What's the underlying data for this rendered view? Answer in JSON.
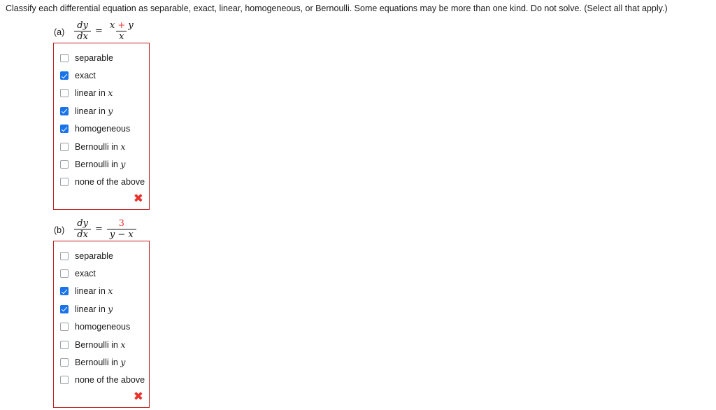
{
  "prompt": "Classify each differential equation as separable, exact, linear, homogeneous, or Bernoulli. Some equations may be more than one kind. Do not solve. (Select all that apply.)",
  "colors": {
    "box_border": "#c41f1f",
    "checkbox_checked": "#1a73e8",
    "highlight_red": "#e8322c",
    "text": "#1a1a1a"
  },
  "problems": [
    {
      "label": "(a)",
      "equation": {
        "lhs_num": "dy",
        "lhs_den": "dx",
        "relation": "=",
        "rhs_num_parts": [
          {
            "text": "x",
            "color": "black"
          },
          {
            "text": "+",
            "color": "red"
          },
          {
            "text": "y",
            "color": "black"
          }
        ],
        "rhs_num_plain": "x + y",
        "rhs_den": "x",
        "plain": "dy/dx = (x + y)/x"
      },
      "options": [
        {
          "label": "separable",
          "checked": false
        },
        {
          "label": "exact",
          "checked": true
        },
        {
          "label": "linear in ",
          "italic": "x",
          "checked": false
        },
        {
          "label": "linear in ",
          "italic": "y",
          "checked": true
        },
        {
          "label": "homogeneous",
          "checked": true
        },
        {
          "label": "Bernoulli in ",
          "italic": "x",
          "checked": false
        },
        {
          "label": "Bernoulli in ",
          "italic": "y",
          "checked": false
        },
        {
          "label": "none of the above",
          "checked": false
        }
      ],
      "feedback": {
        "icon": "cross-mark-icon",
        "symbol": "✖",
        "status": "incorrect"
      }
    },
    {
      "label": "(b)",
      "equation": {
        "lhs_num": "dy",
        "lhs_den": "dx",
        "relation": "=",
        "rhs_num_parts": [
          {
            "text": "3",
            "color": "red"
          }
        ],
        "rhs_num_plain": "3",
        "rhs_den": "y − x",
        "plain": "dy/dx = 3/(y − x)"
      },
      "options": [
        {
          "label": "separable",
          "checked": false
        },
        {
          "label": "exact",
          "checked": false
        },
        {
          "label": "linear in ",
          "italic": "x",
          "checked": true
        },
        {
          "label": "linear in ",
          "italic": "y",
          "checked": true
        },
        {
          "label": "homogeneous",
          "checked": false
        },
        {
          "label": "Bernoulli in ",
          "italic": "x",
          "checked": false
        },
        {
          "label": "Bernoulli in ",
          "italic": "y",
          "checked": false
        },
        {
          "label": "none of the above",
          "checked": false
        }
      ],
      "feedback": {
        "icon": "cross-mark-icon",
        "symbol": "✖",
        "status": "incorrect"
      }
    }
  ]
}
